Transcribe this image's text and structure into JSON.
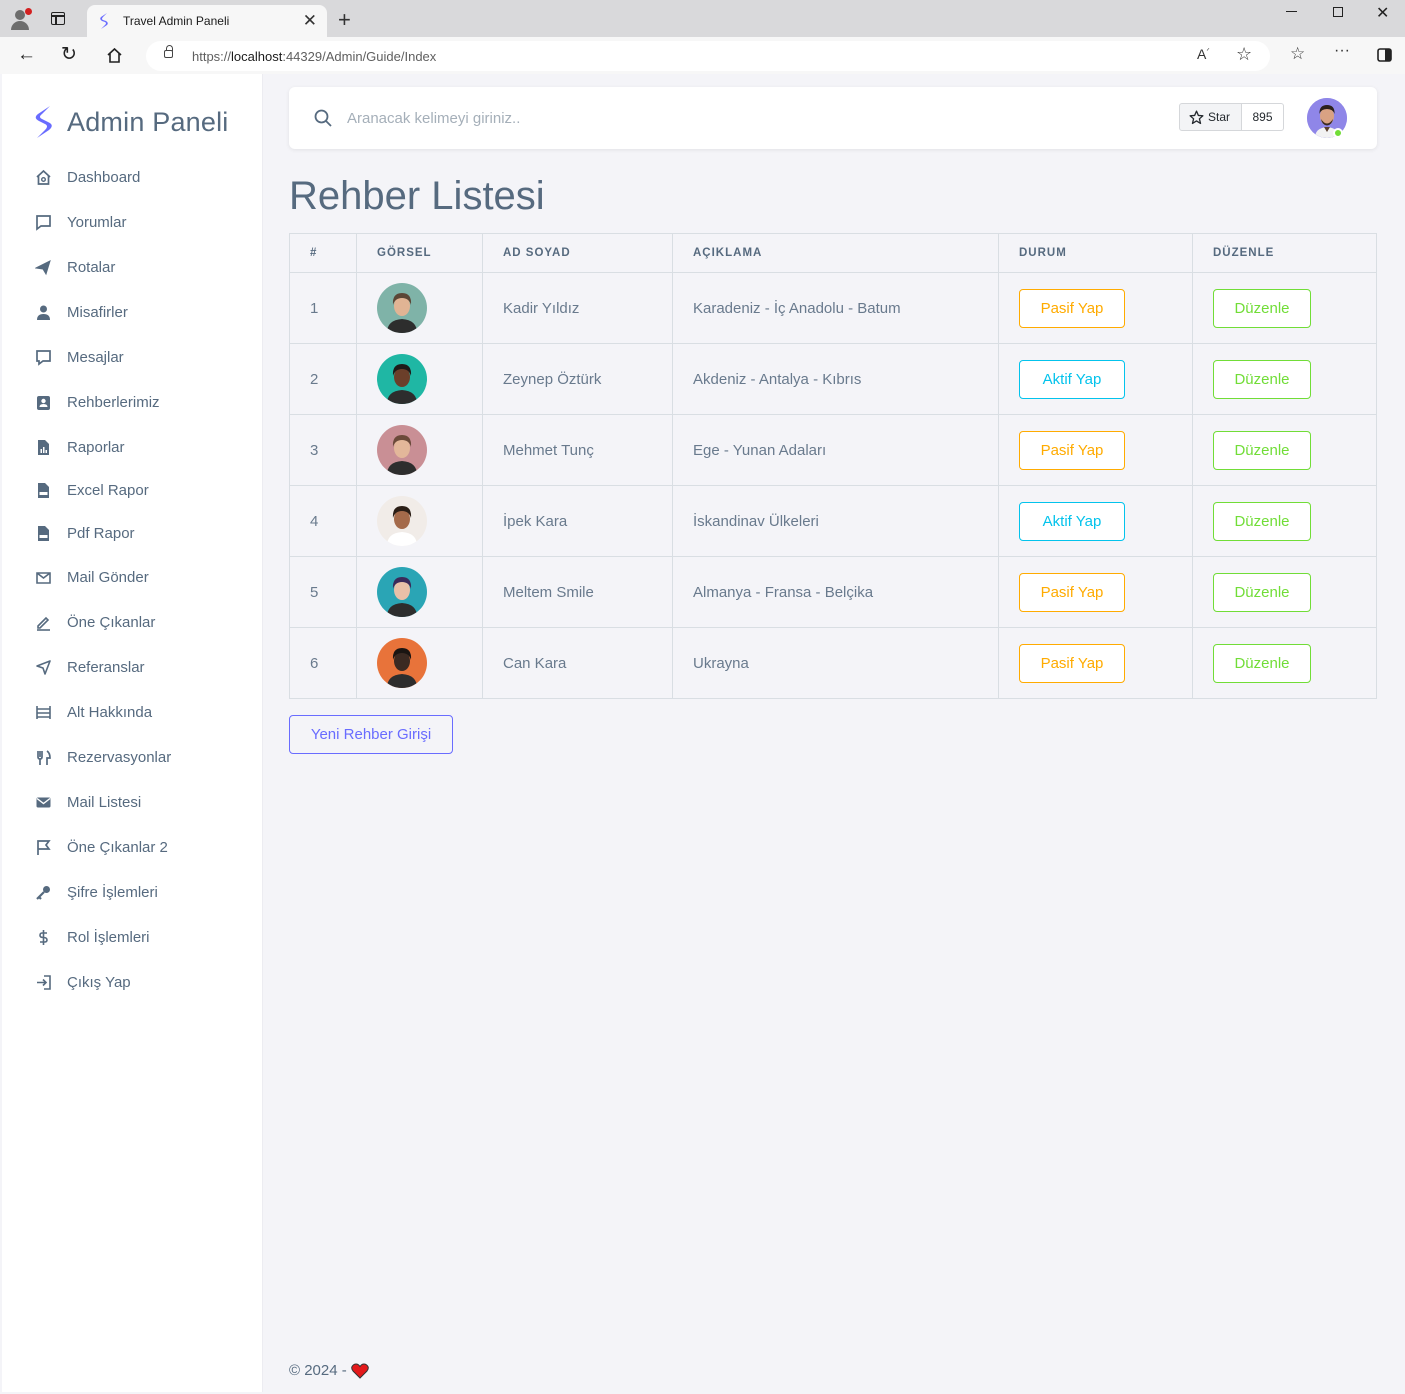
{
  "browser": {
    "tab_title": "Travel Admin Paneli",
    "url_prefix": "https://",
    "url_host": "localhost",
    "url_rest": ":44329/Admin/Guide/Index"
  },
  "sidebar": {
    "brand": "Admin Paneli",
    "items": [
      {
        "label": "Dashboard",
        "icon": "home-icon"
      },
      {
        "label": "Yorumlar",
        "icon": "comment-icon"
      },
      {
        "label": "Rotalar",
        "icon": "plane-icon"
      },
      {
        "label": "Misafirler",
        "icon": "user-icon"
      },
      {
        "label": "Mesajlar",
        "icon": "message-icon"
      },
      {
        "label": "Rehberlerimiz",
        "icon": "contact-card-icon"
      },
      {
        "label": "Raporlar",
        "icon": "report-file-icon"
      },
      {
        "label": "Excel Rapor",
        "icon": "doc-file-icon"
      },
      {
        "label": "Pdf Rapor",
        "icon": "pdf-file-icon"
      },
      {
        "label": "Mail Gönder",
        "icon": "mail-send-icon"
      },
      {
        "label": "Öne Çıkanlar",
        "icon": "pencil-icon"
      },
      {
        "label": "Referanslar",
        "icon": "send-icon"
      },
      {
        "label": "Alt Hakkında",
        "icon": "layout-icon"
      },
      {
        "label": "Rezervasyonlar",
        "icon": "restaurant-icon"
      },
      {
        "label": "Mail Listesi",
        "icon": "envelope-icon"
      },
      {
        "label": "Öne Çıkanlar 2",
        "icon": "bookmark-icon"
      },
      {
        "label": "Şifre İşlemleri",
        "icon": "key-icon"
      },
      {
        "label": "Rol İşlemleri",
        "icon": "dollar-icon"
      },
      {
        "label": "Çıkış Yap",
        "icon": "logout-icon"
      }
    ]
  },
  "topbar": {
    "search_placeholder": "Aranacak kelimeyi giriniz..",
    "star_label": "Star",
    "star_count": "895"
  },
  "page": {
    "title": "Rehber Listesi",
    "new_button": "Yeni Rehber Girişi"
  },
  "table": {
    "headers": [
      "#",
      "GÖRSEL",
      "AD SOYAD",
      "AÇIKLAMA",
      "DURUM",
      "DÜZENLE"
    ],
    "rows": [
      {
        "no": "1",
        "name": "Kadir Yıldız",
        "desc": "Karadeniz - İç Anadolu - Batum",
        "status": "Pasif Yap",
        "status_kind": "warning",
        "edit": "Düzenle",
        "avatar_color": "#7fb3a8"
      },
      {
        "no": "2",
        "name": "Zeynep Öztürk",
        "desc": "Akdeniz - Antalya - Kıbrıs",
        "status": "Aktif Yap",
        "status_kind": "info",
        "edit": "Düzenle",
        "avatar_color": "#1fb7a4"
      },
      {
        "no": "3",
        "name": "Mehmet Tunç",
        "desc": "Ege - Yunan Adaları",
        "status": "Pasif Yap",
        "status_kind": "warning",
        "edit": "Düzenle",
        "avatar_color": "#c98f95"
      },
      {
        "no": "4",
        "name": "İpek Kara",
        "desc": "İskandinav Ülkeleri",
        "status": "Aktif Yap",
        "status_kind": "info",
        "edit": "Düzenle",
        "avatar_color": "#f1ece8"
      },
      {
        "no": "5",
        "name": "Meltem Smile",
        "desc": "Almanya - Fransa - Belçika",
        "status": "Pasif Yap",
        "status_kind": "warning",
        "edit": "Düzenle",
        "avatar_color": "#2aa5b5"
      },
      {
        "no": "6",
        "name": "Can Kara",
        "desc": "Ukrayna",
        "status": "Pasif Yap",
        "status_kind": "warning",
        "edit": "Düzenle",
        "avatar_color": "#e8733a"
      }
    ]
  },
  "footer": {
    "text": "© 2024 -"
  },
  "colors": {
    "primary": "#696cff",
    "warning": "#ffab00",
    "info": "#03c3ec",
    "success": "#71dd37",
    "heart": "#e3191b"
  }
}
